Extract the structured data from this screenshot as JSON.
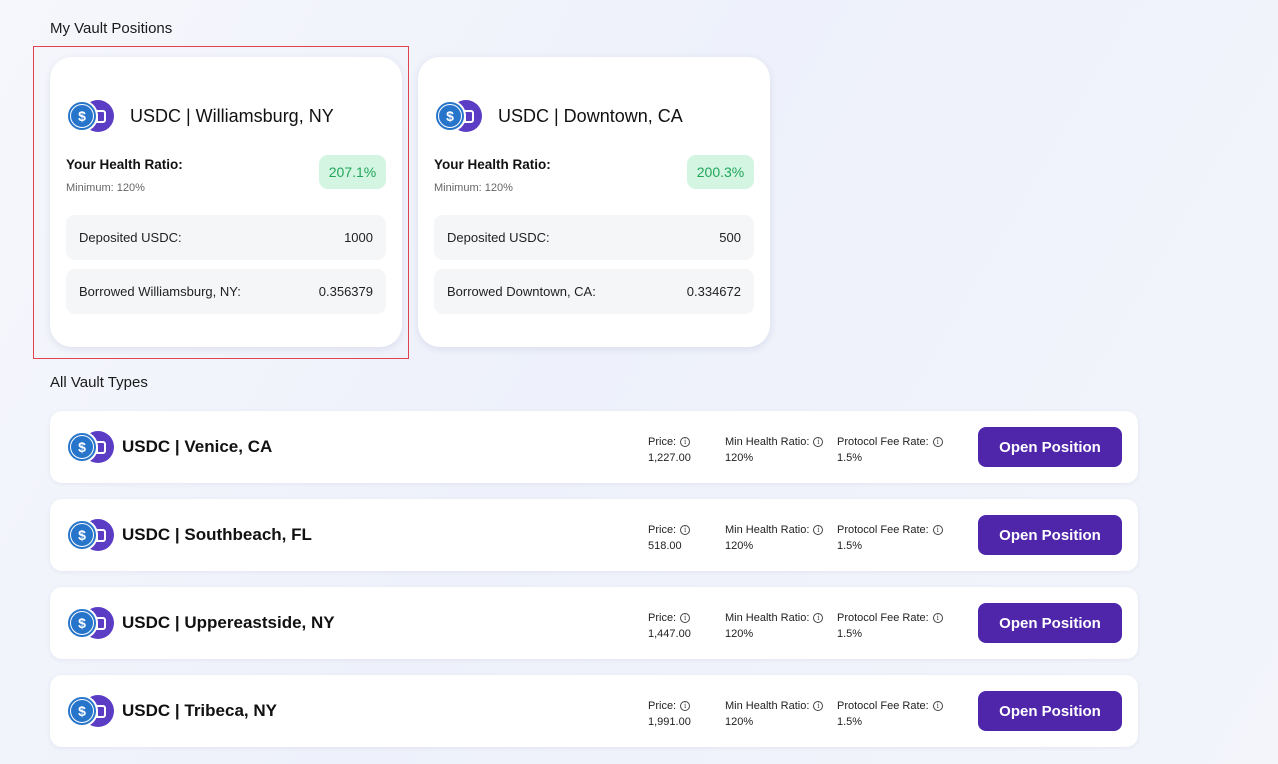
{
  "sections": {
    "my_positions": "My Vault Positions",
    "all_types": "All Vault Types"
  },
  "positions": [
    {
      "name": "USDC | Williamsburg, NY",
      "health_label": "Your Health Ratio:",
      "health_min": "Minimum: 120%",
      "health_value": "207.1%",
      "deposited_label": "Deposited USDC:",
      "deposited_value": "1000",
      "borrowed_label": "Borrowed Williamsburg, NY:",
      "borrowed_value": "0.356379"
    },
    {
      "name": "USDC | Downtown, CA",
      "health_label": "Your Health Ratio:",
      "health_min": "Minimum: 120%",
      "health_value": "200.3%",
      "deposited_label": "Deposited USDC:",
      "deposited_value": "500",
      "borrowed_label": "Borrowed Downtown, CA:",
      "borrowed_value": "0.334672"
    }
  ],
  "vault_types": [
    {
      "name": "USDC | Venice, CA",
      "price_label": "Price:",
      "price": "1,227.00",
      "min_label": "Min Health Ratio:",
      "min": "120%",
      "fee_label": "Protocol Fee Rate:",
      "fee": "1.5%",
      "button": "Open Position"
    },
    {
      "name": "USDC | Southbeach, FL",
      "price_label": "Price:",
      "price": "518.00",
      "min_label": "Min Health Ratio:",
      "min": "120%",
      "fee_label": "Protocol Fee Rate:",
      "fee": "1.5%",
      "button": "Open Position"
    },
    {
      "name": "USDC | Uppereastside, NY",
      "price_label": "Price:",
      "price": "1,447.00",
      "min_label": "Min Health Ratio:",
      "min": "120%",
      "fee_label": "Protocol Fee Rate:",
      "fee": "1.5%",
      "button": "Open Position"
    },
    {
      "name": "USDC | Tribeca, NY",
      "price_label": "Price:",
      "price": "1,991.00",
      "min_label": "Min Health Ratio:",
      "min": "120%",
      "fee_label": "Protocol Fee Rate:",
      "fee": "1.5%",
      "button": "Open Position"
    }
  ],
  "icons": {
    "usdc": "usdc-token-icon",
    "vault": "vault-token-icon",
    "info": "info-icon"
  },
  "colors": {
    "accent": "#4f26aa",
    "health_bg": "#d3f5e2",
    "health_text": "#21a65a",
    "usdc_blue": "#2775ca",
    "selection": "#e0434f"
  }
}
